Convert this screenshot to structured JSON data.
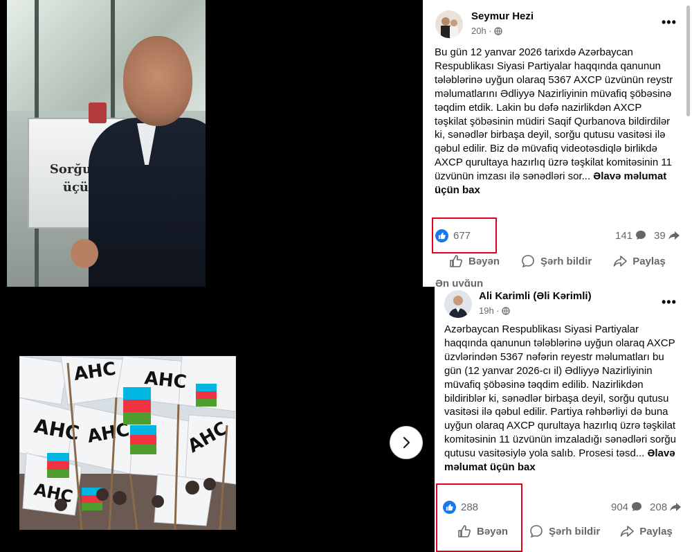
{
  "left": {
    "photo_top": {
      "box_sign": [
        "Sorğular",
        "üçün"
      ]
    }
  },
  "nav": {
    "next_icon": "chevron-right-icon"
  },
  "posts": [
    {
      "author": "Seymur Hezi",
      "time": "20h ·",
      "audience_icon": "globe-icon",
      "more": "•••",
      "text": "Bu gün 12 yanvar 2026 tarixdə Azərbaycan Respublikası Siyasi Partiyalar haqqında qanunun tələblərinə uyğun olaraq 5367 AXCP üzvünün reystr məlumatlarını Ədliyyə Nazirliyinin müvafiq şöbəsinə təqdim etdik. Lakin bu dəfə nazirlikdən AXCP təşkilat şöbəsinin müdiri Saqif Qurbanova bildirdilər ki, sənədlər birbaşa deyil, sorğu qutusu vasitəsi ilə qəbul edilir. Biz də müvafiq videotəsdiqlə birlikdə AXCP qurultaya hazırlıq üzrə təşkilat komitəsinin 11 üzvünün imzası ilə sənədləri sor...",
      "see_more": "Əlavə məlumat üçün bax",
      "likes": "677",
      "comments": "141",
      "shares": "39",
      "actions": {
        "like": "Bəyən",
        "comment": "Şərh bildir",
        "share": "Paylaş"
      },
      "sort_label": "Ən uyğun"
    },
    {
      "author": "Ali Karimli (Əli Kərimli)",
      "time": "19h ·",
      "audience_icon": "globe-icon",
      "more": "•••",
      "text": "Azərbaycan Respublikası Siyasi Partiyalar haqqında qanunun tələblərinə uyğun olaraq AXCP üzvlərindən 5367 nəfərin reyestr məlumatları bu gün (12 yanvar 2026-cı il) Ədliyyə Nazirliyinin müvafiq şöbəsinə təqdim edilib. Nazirlikdən bildiriblər ki, sənədlər birbaşa deyil, sorğu qutusu vasitəsi ilə qəbul edilir. Partiya rəhbərliyi də buna uyğun olaraq AXCP qurultaya hazırlıq üzrə təşkilat komitəsinin 11 üzvünün imzaladığı sənədləri sorğu qutusu vasitəsiylə yola salıb. Prosesi təsd...",
      "see_more": "Əlavə məlumat üçün bax",
      "likes": "288",
      "comments": "904",
      "shares": "208",
      "actions": {
        "like": "Bəyən",
        "comment": "Şərh bildir",
        "share": "Paylaş"
      }
    }
  ],
  "colors": {
    "accent": "#1877f2",
    "highlight": "#e0001b"
  }
}
